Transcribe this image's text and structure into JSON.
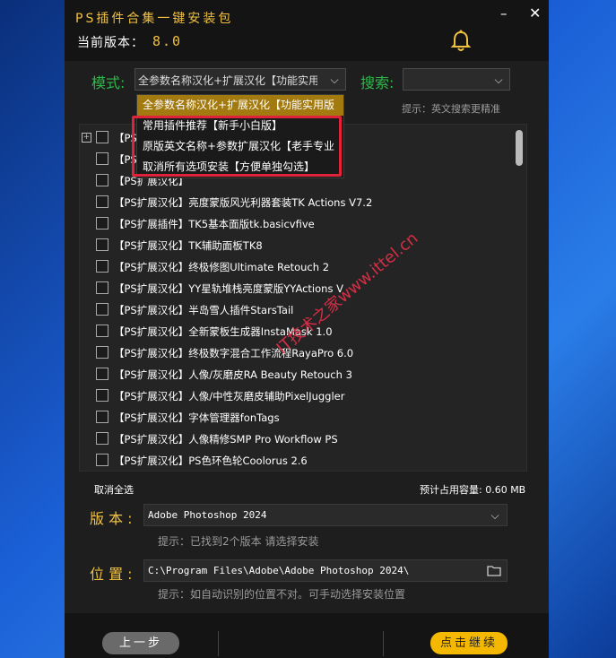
{
  "window": {
    "title": "PS插件合集一键安装包",
    "version_label": "当前版本：",
    "version_number": "8.0",
    "minimize": "–",
    "close": "✕"
  },
  "mode": {
    "label": "模式:",
    "selected": "全参数名称汉化+扩展汉化【功能实用版",
    "options": [
      "全参数名称汉化+扩展汉化【功能实用版",
      "常用插件推荐【新手小白版】",
      "原版英文名称+参数扩展汉化【老手专业",
      "取消所有选项安装【方便单独勾选】"
    ]
  },
  "search": {
    "label": "搜索:",
    "value": "",
    "hint": "提示：英文搜索更精准"
  },
  "plugin_list": [
    "【PS扩展汉化】",
    "【PS扩展汉化】",
    "【PS扩展汉化】",
    "【PS扩展汉化】亮度蒙版风光利器套装TK Actions V7.2",
    "【PS扩展插件】TK5基本面版tk.basicvfive",
    "【PS扩展汉化】TK辅助面板TK8",
    "【PS扩展汉化】终极修图Ultimate Retouch 2",
    "【PS扩展汉化】YY星轨堆栈亮度蒙版YYActions V",
    "【PS扩展汉化】半岛雪人插件StarsTail",
    "【PS扩展汉化】全新蒙板生成器InstaMask 1.0",
    "【PS扩展汉化】终极数字混合工作流程RayaPro 6.0",
    "【PS扩展汉化】人像/灰磨皮RA Beauty Retouch 3",
    "【PS扩展汉化】人像/中性灰磨皮辅助PixelJuggler",
    "【PS扩展汉化】字体管理器fonTags",
    "【PS扩展汉化】人像精修SMP Pro Workflow PS",
    "【PS扩展汉化】PS色环色轮Coolorus 2.6"
  ],
  "list_footer": {
    "deselect_all": "取消全选",
    "space_label": "预计占用容量: 0.60 MB"
  },
  "edition": {
    "label": "版 本 :",
    "value": "Adobe Photoshop 2024",
    "hint": "提示：已找到2个版本 请选择安装"
  },
  "location": {
    "label": "位 置 :",
    "value": "C:\\Program Files\\Adobe\\Adobe Photoshop 2024\\",
    "hint": "提示：如自动识别的位置不对。可手动选择安装位置"
  },
  "buttons": {
    "back": "上一步",
    "next": "点击继续"
  },
  "watermark": "IT技术之家www.ittel.cn",
  "colors": {
    "accent_gold": "#f0c040",
    "label_green": "#2fb84a",
    "highlight_box": "#e0223a",
    "selected_item": "#a37a10"
  }
}
